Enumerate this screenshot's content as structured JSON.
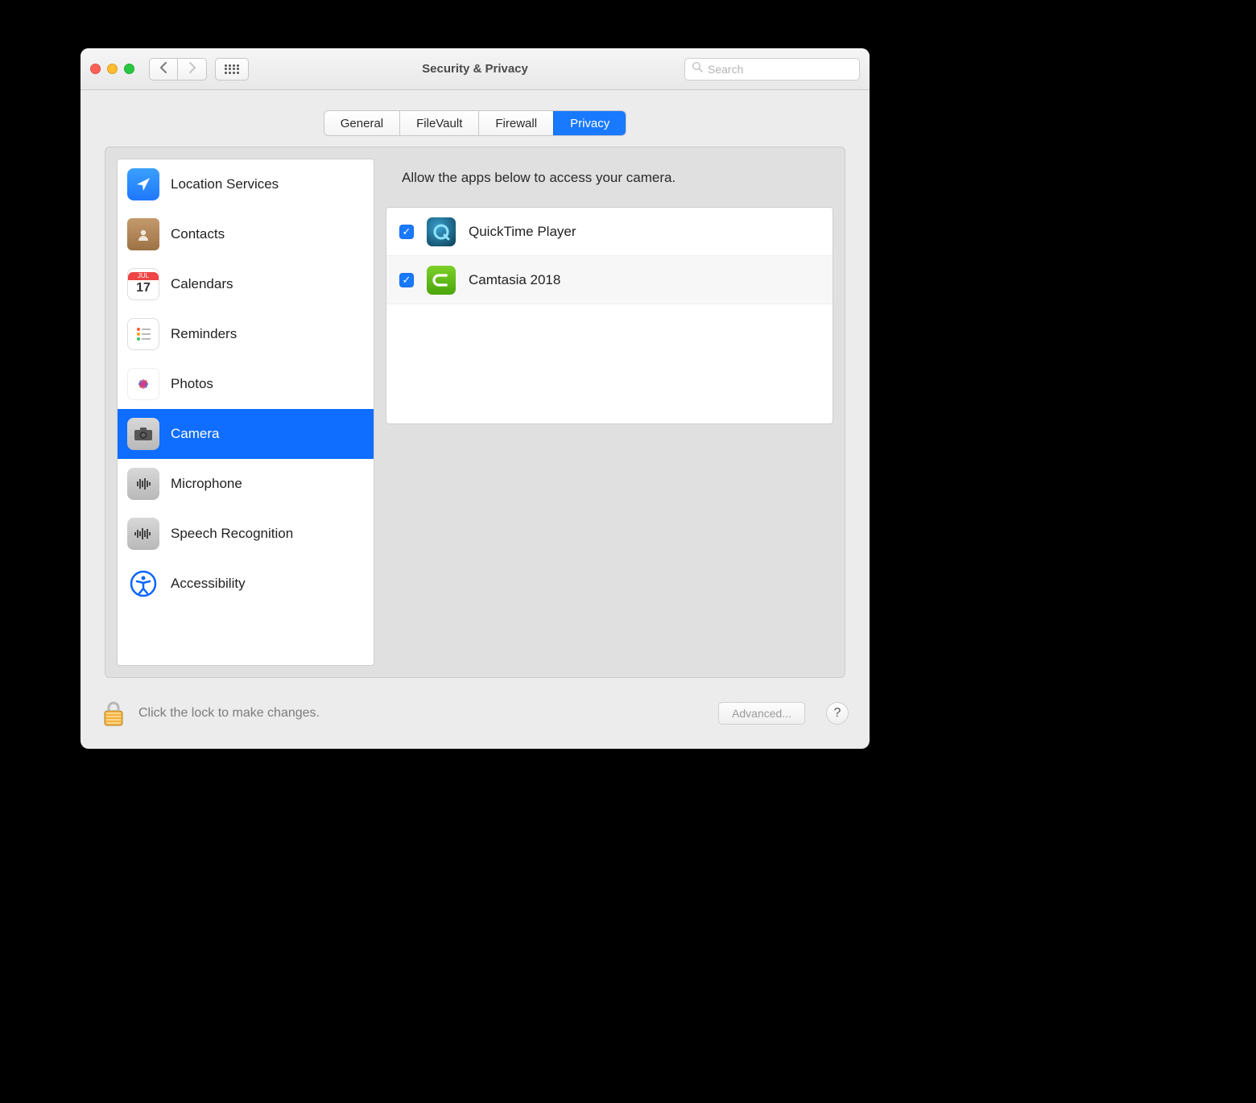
{
  "window": {
    "title": "Security & Privacy"
  },
  "search": {
    "placeholder": "Search"
  },
  "tabs": {
    "general": "General",
    "filevault": "FileVault",
    "firewall": "Firewall",
    "privacy": "Privacy"
  },
  "sidebar": {
    "items": [
      {
        "label": "Location Services",
        "icon": "location-icon"
      },
      {
        "label": "Contacts",
        "icon": "contacts-icon"
      },
      {
        "label": "Calendars",
        "icon": "calendar-icon"
      },
      {
        "label": "Reminders",
        "icon": "reminders-icon"
      },
      {
        "label": "Photos",
        "icon": "photos-icon"
      },
      {
        "label": "Camera",
        "icon": "camera-icon",
        "selected": true
      },
      {
        "label": "Microphone",
        "icon": "microphone-icon"
      },
      {
        "label": "Speech Recognition",
        "icon": "speech-icon"
      },
      {
        "label": "Accessibility",
        "icon": "accessibility-icon"
      }
    ]
  },
  "detail": {
    "header": "Allow the apps below to access your camera.",
    "apps": [
      {
        "name": "QuickTime Player",
        "checked": true,
        "icon": "quicktime-icon"
      },
      {
        "name": "Camtasia 2018",
        "checked": true,
        "icon": "camtasia-icon"
      }
    ]
  },
  "footer": {
    "lock_text": "Click the lock to make changes.",
    "advanced_label": "Advanced...",
    "help_label": "?"
  },
  "calendar_day": "17"
}
